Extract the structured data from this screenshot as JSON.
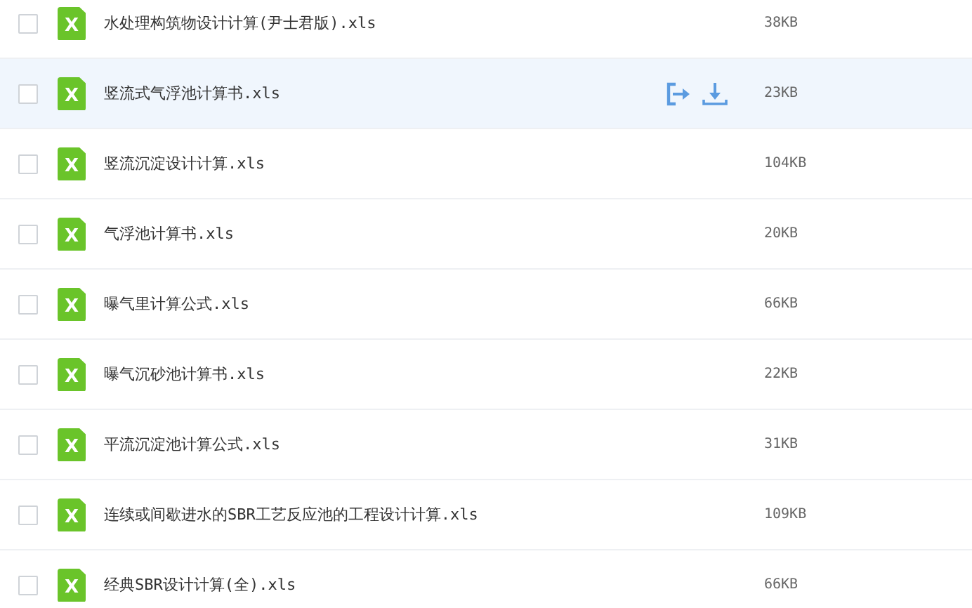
{
  "files": [
    {
      "name": "水处理构筑物设计计算(尹士君版).xls",
      "size": "38KB",
      "icon_letter": "X",
      "checked": false,
      "hovered": false
    },
    {
      "name": "竖流式气浮池计算书.xls",
      "size": "23KB",
      "icon_letter": "X",
      "checked": false,
      "hovered": true
    },
    {
      "name": "竖流沉淀设计计算.xls",
      "size": "104KB",
      "icon_letter": "X",
      "checked": false,
      "hovered": false
    },
    {
      "name": "气浮池计算书.xls",
      "size": "20KB",
      "icon_letter": "X",
      "checked": false,
      "hovered": false
    },
    {
      "name": "曝气里计算公式.xls",
      "size": "66KB",
      "icon_letter": "X",
      "checked": false,
      "hovered": false
    },
    {
      "name": "曝气沉砂池计算书.xls",
      "size": "22KB",
      "icon_letter": "X",
      "checked": false,
      "hovered": false
    },
    {
      "name": "平流沉淀池计算公式.xls",
      "size": "31KB",
      "icon_letter": "X",
      "checked": false,
      "hovered": false
    },
    {
      "name": "连续或间歇进水的SBR工艺反应池的工程设计计算.xls",
      "size": "109KB",
      "icon_letter": "X",
      "checked": false,
      "hovered": false
    },
    {
      "name": "经典SBR设计计算(全).xls",
      "size": "66KB",
      "icon_letter": "X",
      "checked": false,
      "hovered": false
    }
  ]
}
